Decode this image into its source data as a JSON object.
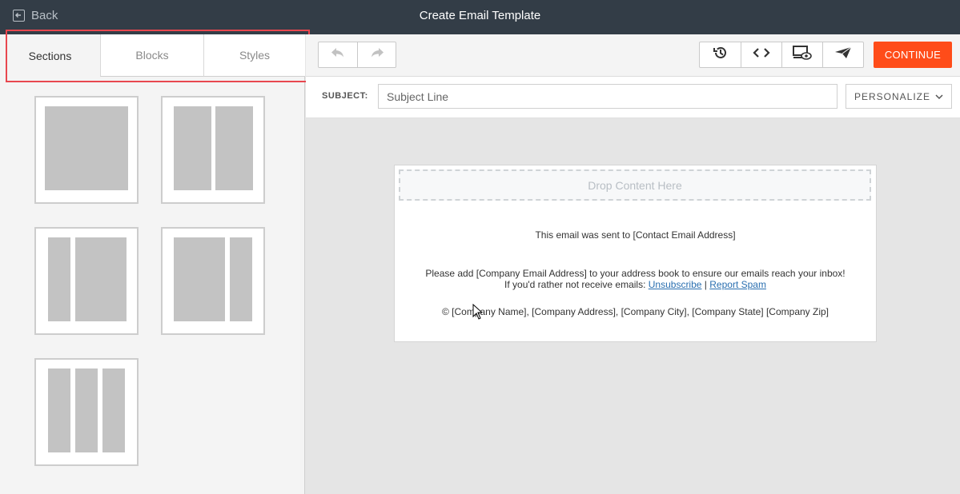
{
  "topbar": {
    "back_label": "Back",
    "title": "Create Email Template"
  },
  "tabs": [
    {
      "label": "Sections",
      "active": true
    },
    {
      "label": "Blocks",
      "active": false
    },
    {
      "label": "Styles",
      "active": false
    }
  ],
  "layouts": [
    "one-column",
    "two-column",
    "narrow-wide",
    "wide-narrow",
    "three-column"
  ],
  "toolbar": {
    "continue_label": "CONTINUE",
    "icons": [
      "undo-icon",
      "redo-icon",
      "history-icon",
      "code-icon",
      "preview-icon",
      "send-test-icon"
    ]
  },
  "subject": {
    "label": "SUBJECT:",
    "placeholder": "Subject Line",
    "value": "",
    "personalize_label": "PERSONALIZE"
  },
  "email": {
    "drop_label": "Drop Content Here",
    "sent_to": "This email was sent to [Contact Email Address]",
    "add_line": "Please add [Company Email Address] to your address book to ensure our emails reach your inbox!",
    "optout_prefix": "If you'd rather not receive emails:",
    "unsubscribe": "Unsubscribe",
    "separator": "|",
    "report_spam": "Report Spam",
    "address": "© [Company Name], [Company Address], [Company City], [Company State] [Company Zip]"
  },
  "colors": {
    "topbar": "#333d47",
    "accent": "#ff4c19",
    "highlight": "#e8474f",
    "link": "#2a6fb0"
  }
}
